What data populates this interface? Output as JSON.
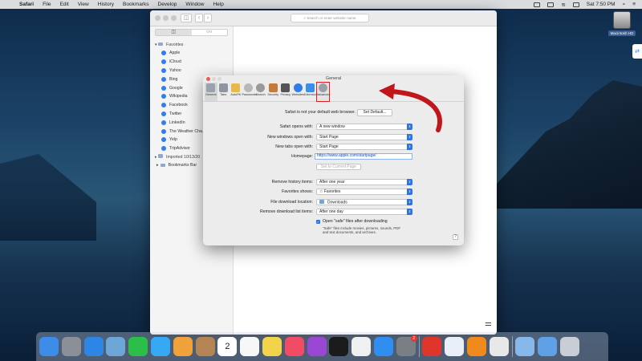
{
  "menubar": {
    "apple": "",
    "items": [
      "Safari",
      "File",
      "Edit",
      "View",
      "History",
      "Bookmarks",
      "Develop",
      "Window",
      "Help"
    ],
    "time": "Sat 7:50 PM"
  },
  "desktop": {
    "disk_label": "Macintosh HD"
  },
  "safari": {
    "address_placeholder": "Search or enter website name",
    "sidebar": {
      "tab_bookmarks": "◫",
      "tab_reading": "○○",
      "favorites_header": "Favorites",
      "favorites": [
        "Apple",
        "iCloud",
        "Yahoo",
        "Bing",
        "Google",
        "Wikipedia",
        "Facebook",
        "Twitter",
        "LinkedIn",
        "The Weather Cha...",
        "Yelp",
        "TripAdvisor"
      ],
      "imported": "Imported 10/13/20",
      "bookmarks_bar": "Bookmarks Bar"
    }
  },
  "prefs": {
    "title": "General",
    "tabs": [
      "General",
      "Tabs",
      "AutoFill",
      "Passwords",
      "Search",
      "Security",
      "Privacy",
      "Websites",
      "Extensions",
      "Advanced"
    ],
    "default_browser_text": "Safari is not your default web browser.",
    "set_default_btn": "Set Default...",
    "opens_with_label": "Safari opens with:",
    "opens_with_value": "A new window",
    "new_windows_label": "New windows open with:",
    "new_windows_value": "Start Page",
    "new_tabs_label": "New tabs open with:",
    "new_tabs_value": "Start Page",
    "homepage_label": "Homepage:",
    "homepage_value": "https://www.apple.com/startpage/",
    "set_current_btn": "Set to Current Page",
    "remove_history_label": "Remove history items:",
    "remove_history_value": "After one year",
    "favorites_shows_label": "Favorites shows:",
    "favorites_shows_value": "Favorites",
    "download_location_label": "File download location:",
    "download_location_value": "Downloads",
    "remove_download_label": "Remove download list items:",
    "remove_download_value": "After one day",
    "safe_files_label": "Open \"safe\" files after downloading",
    "safe_files_note": "\"Safe\" files include movies, pictures, sounds, PDF and text documents, and archives.",
    "help": "?"
  },
  "dock": {
    "apps": [
      {
        "name": "Finder",
        "color": "#3c8ce8"
      },
      {
        "name": "Launchpad",
        "color": "#8a8f98"
      },
      {
        "name": "Safari",
        "color": "#2d86e6"
      },
      {
        "name": "Preview",
        "color": "#6fa6d8"
      },
      {
        "name": "FaceTime",
        "color": "#2bbf4a"
      },
      {
        "name": "Messages",
        "color": "#36a9f5"
      },
      {
        "name": "Photos",
        "color": "#f1a13a"
      },
      {
        "name": "Contacts",
        "color": "#b48454"
      },
      {
        "name": "Calendar",
        "color": "#ffffff"
      },
      {
        "name": "Reminders",
        "color": "#f7f7f7"
      },
      {
        "name": "Notes",
        "color": "#f3d34a"
      },
      {
        "name": "Music",
        "color": "#f24b65"
      },
      {
        "name": "Podcasts",
        "color": "#9b47d6"
      },
      {
        "name": "TV",
        "color": "#1b1b1b"
      },
      {
        "name": "News",
        "color": "#f0f0f0"
      },
      {
        "name": "App Store",
        "color": "#2f8ef0"
      },
      {
        "name": "System Preferences",
        "color": "#7a7f86"
      },
      {
        "name": "AnyDesk",
        "color": "#e0352b"
      },
      {
        "name": "TeamViewer",
        "color": "#e9eff8"
      },
      {
        "name": "VLC",
        "color": "#f08a1c"
      },
      {
        "name": "Chrome",
        "color": "#e8e8e8"
      },
      {
        "name": "Folder",
        "color": "#86b8ea"
      },
      {
        "name": "Downloads",
        "color": "#5fa0e6"
      },
      {
        "name": "Trash",
        "color": "#c9ced6"
      }
    ],
    "calendar_day": "2",
    "prefs_badge": "2"
  }
}
